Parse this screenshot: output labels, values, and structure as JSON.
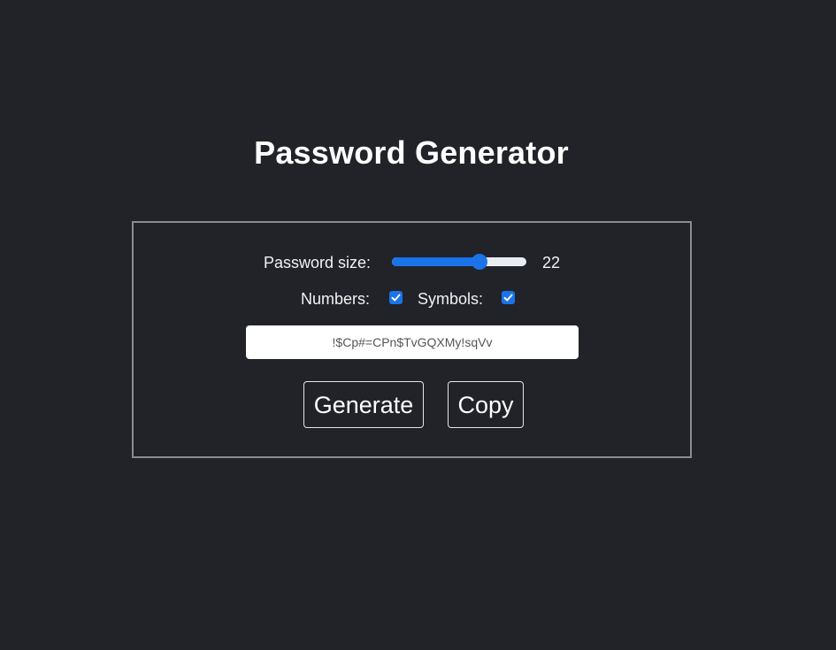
{
  "title": "Password Generator",
  "size_label": "Password size:",
  "size_value": "22",
  "slider_fraction": 0.65,
  "numbers_label": "Numbers:",
  "numbers_checked": true,
  "symbols_label": "Symbols:",
  "symbols_checked": true,
  "password": "!$Cp#=CPn$TvGQXMy!sqVv",
  "generate_label": "Generate",
  "copy_label": "Copy",
  "colors": {
    "background": "#212328",
    "accent": "#1a73e8",
    "panel_border": "#8a8c90"
  }
}
